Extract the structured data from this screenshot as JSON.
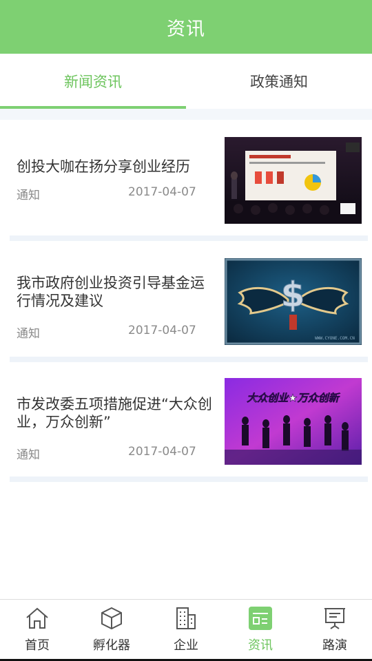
{
  "header": {
    "title": "资讯"
  },
  "tabs": [
    {
      "label": "新闻资讯",
      "active": true
    },
    {
      "label": "政策通知",
      "active": false
    }
  ],
  "articles": [
    {
      "title": "创投大咖在扬分享创业经历",
      "tag": "通知",
      "date": "2017-04-07",
      "image": "presentation-photo"
    },
    {
      "title": "我市政府创业投资引导基金运行情况及建议",
      "tag": "通知",
      "date": "2017-04-07",
      "image": "winged-dollar-sign"
    },
    {
      "title": "市发改委五项措施促进“大众创业，万众创新”",
      "tag": "通知",
      "date": "2017-04-07",
      "image": "mass-entrepreneurship-poster"
    }
  ],
  "thumb_text": {
    "poster": "大众创业★万众创新",
    "watermark": "WWW.CYONE.COM.CN"
  },
  "bottom_nav": [
    {
      "label": "首页",
      "icon": "home-icon"
    },
    {
      "label": "孵化器",
      "icon": "cube-icon"
    },
    {
      "label": "企业",
      "icon": "building-icon"
    },
    {
      "label": "资讯",
      "icon": "news-icon",
      "active": true
    },
    {
      "label": "路演",
      "icon": "presentation-board-icon"
    }
  ],
  "colors": {
    "brand": "#7ed072",
    "active_text": "#6cc45c",
    "separator": "#eef3f9"
  }
}
